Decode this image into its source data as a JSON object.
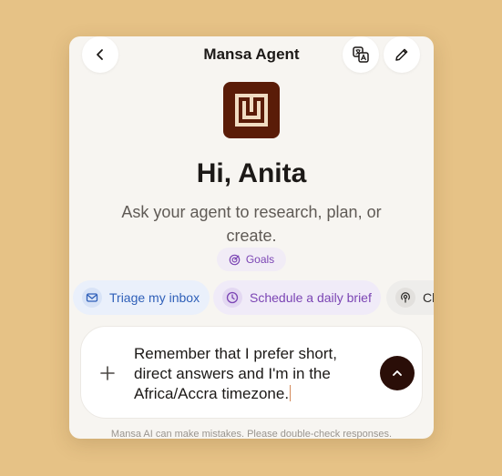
{
  "header": {
    "title": "Mansa Agent",
    "back_icon": "chevron-left-icon",
    "translate_icon": "translate-icon",
    "edit_icon": "pencil-icon"
  },
  "hero": {
    "greeting": "Hi, Anita",
    "subtitle": "Ask your agent to research, plan, or create.",
    "goals_label": "Goals"
  },
  "suggestions": [
    {
      "label": "Triage my inbox",
      "icon": "mail-icon"
    },
    {
      "label": "Schedule a daily brief",
      "icon": "clock-icon"
    },
    {
      "label": "Ch",
      "icon": "podcast-icon"
    }
  ],
  "composer": {
    "text": "Remember that I prefer short, direct answers and I'm in the Africa/Accra timezone."
  },
  "footer": {
    "disclaimer": "Mansa AI can make mistakes. Please double-check responses."
  },
  "colors": {
    "background": "#e6c286",
    "brand": "#5a1c08",
    "send_button": "#2a0e08",
    "inbox_chip": "#2e5fb8",
    "brief_chip": "#7b45b4"
  }
}
